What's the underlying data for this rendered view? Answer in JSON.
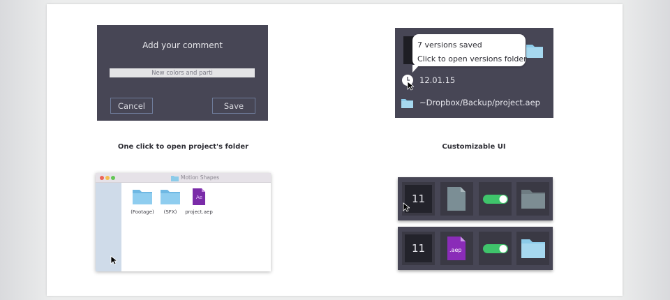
{
  "comment_dialog": {
    "title": "Add your comment",
    "input_value": "New colors and parti",
    "cancel_label": "Cancel",
    "save_label": "Save"
  },
  "versions": {
    "tooltip_line1": "7 versions saved",
    "tooltip_line2": "Click to open versions folder",
    "date": "12.01.15",
    "path": "~Dropbox/Backup/project.aep"
  },
  "captions": {
    "left": "One click to open project's folder",
    "right": "Customizable UI"
  },
  "finder": {
    "title": "Motion Shapes",
    "items": [
      {
        "label": "(Footage)",
        "icon": "folder-icon"
      },
      {
        "label": "(SFX)",
        "icon": "folder-icon"
      },
      {
        "label": "project.aep",
        "icon": "ae-file-icon"
      }
    ],
    "ae_badge": "Ae"
  },
  "custom_ui": {
    "row1": {
      "number": "11"
    },
    "row2": {
      "number": "11",
      "file_badge": ".aep"
    }
  },
  "colors": {
    "panel": "#474655",
    "folder": "#7fc4e8",
    "toggle": "#3fc46b",
    "ae_purple": "#7a2ba8"
  }
}
